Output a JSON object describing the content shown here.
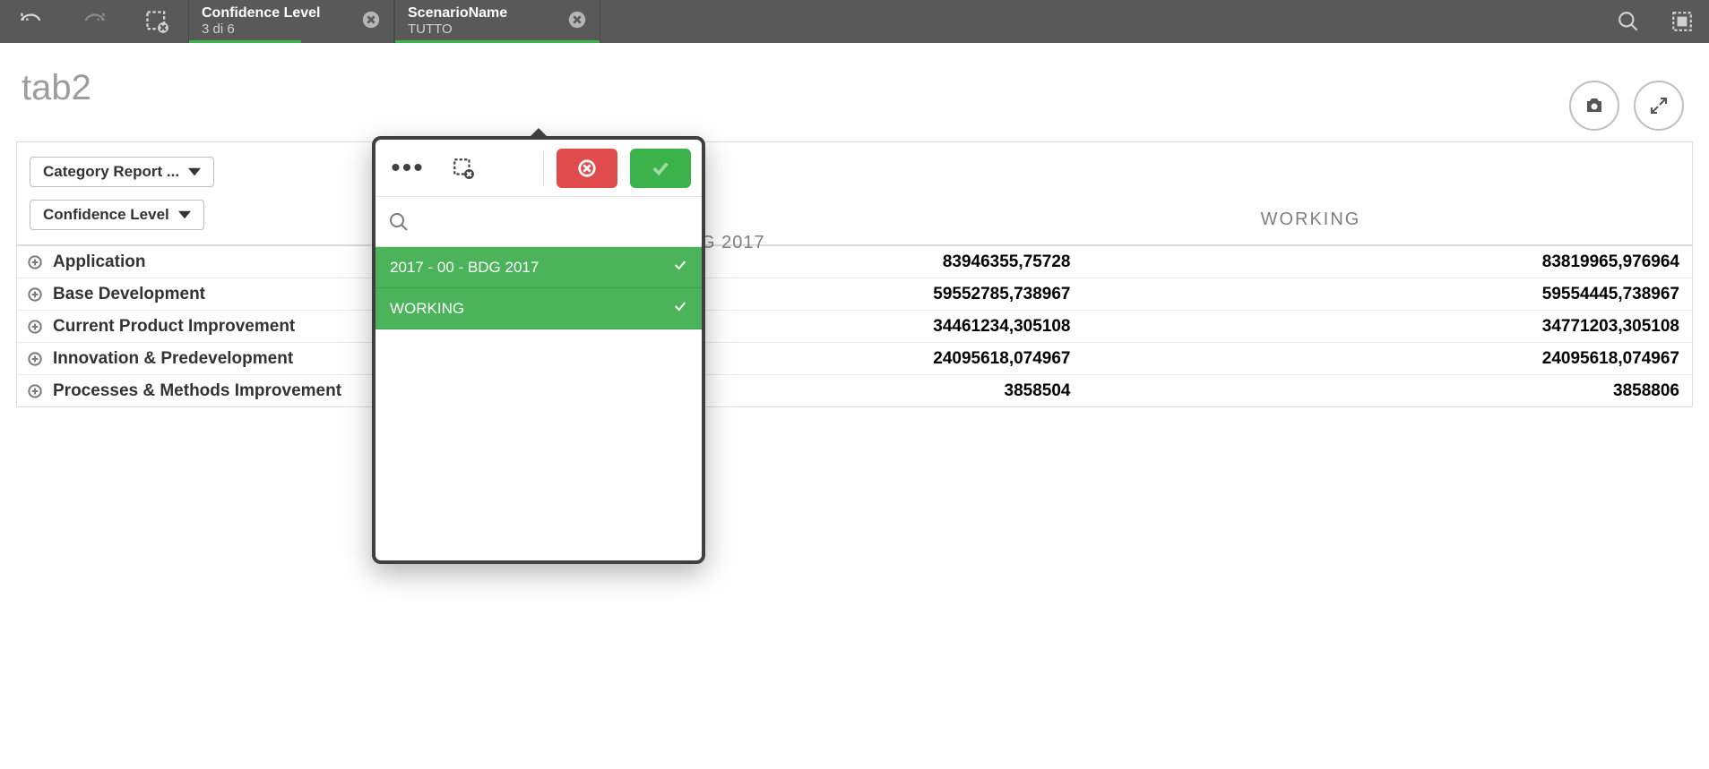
{
  "topbar": {
    "filters": [
      {
        "title": "Confidence Level",
        "value": "3 di 6",
        "green_fraction": 0.55
      },
      {
        "title": "ScenarioName",
        "value": "TUTTO",
        "green_fraction": 1.0
      }
    ]
  },
  "sheet": {
    "title": "tab2"
  },
  "dropdowns": {
    "category_report": "Category Report ...",
    "confidence_level": "Confidence Level"
  },
  "columns": {
    "c1_partial": "G 2017",
    "c2": "WORKING"
  },
  "rows": [
    {
      "label": "Application",
      "v1": "83946355,75728",
      "v2": "83819965,976964"
    },
    {
      "label": "Base Development",
      "v1": "59552785,738967",
      "v2": "59554445,738967"
    },
    {
      "label": "Current Product Improvement",
      "v1": "34461234,305108",
      "v2": "34771203,305108"
    },
    {
      "label": "Innovation & Predevelopment",
      "v1": "24095618,074967",
      "v2": "24095618,074967"
    },
    {
      "label": "Processes & Methods Improvement",
      "v1": "3858504",
      "v2": "3858806"
    }
  ],
  "popup": {
    "items": [
      {
        "label": "2017 - 00 - BDG 2017",
        "selected": true
      },
      {
        "label": "WORKING",
        "selected": true
      }
    ]
  }
}
